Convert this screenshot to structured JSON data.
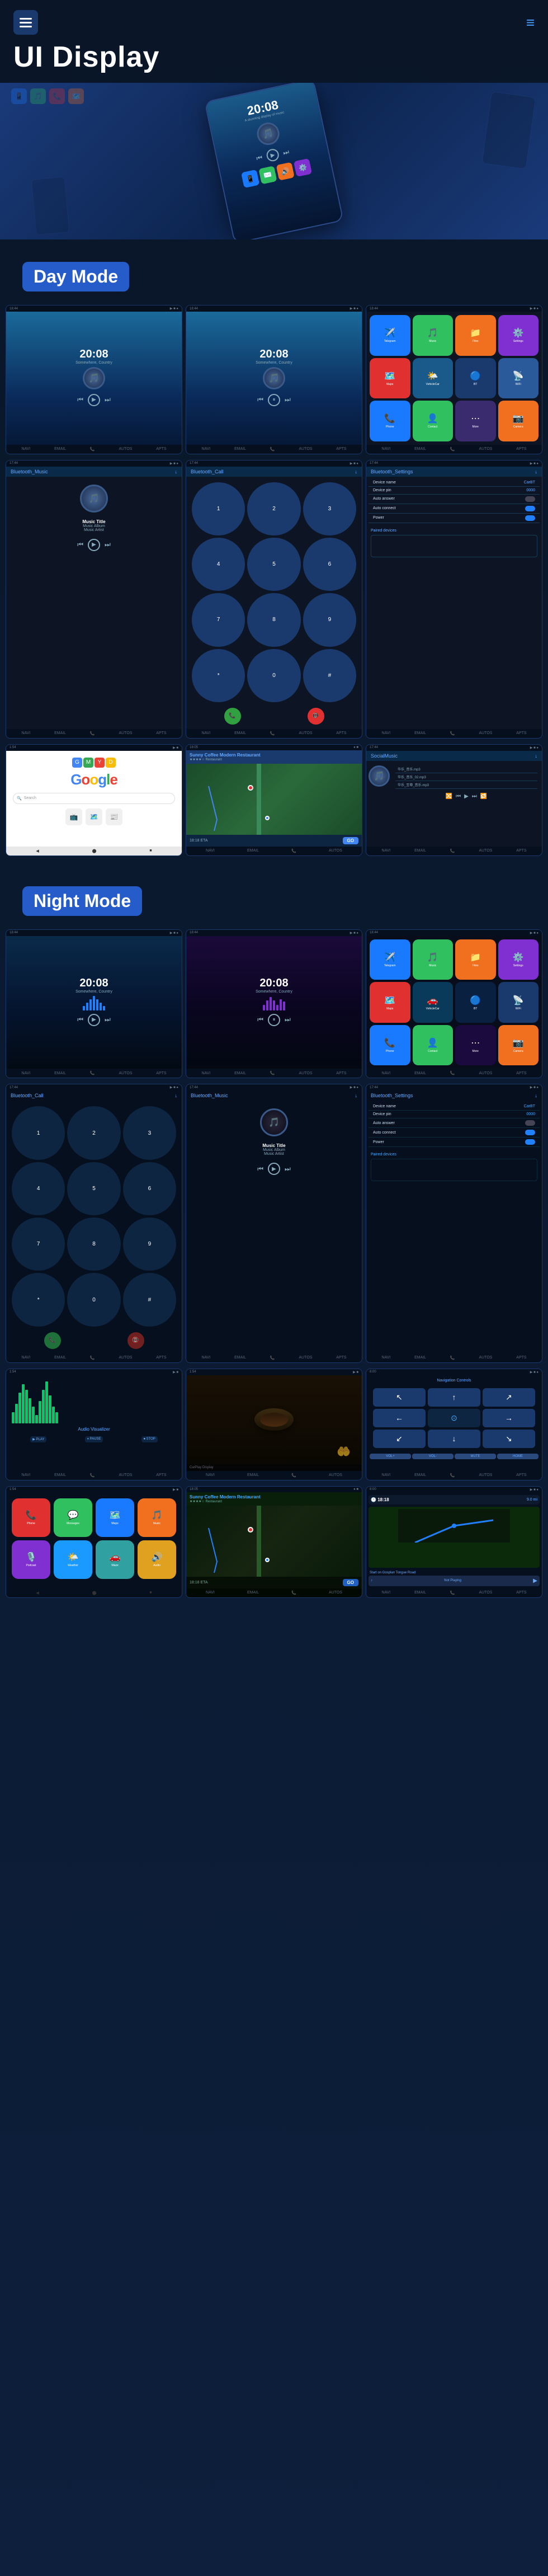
{
  "header": {
    "title": "UI Display",
    "menu_icon": "≡",
    "nav_icon": "≡"
  },
  "hero": {
    "time": "20:08",
    "subtitle": "A stunning display of music"
  },
  "day_mode": {
    "label": "Day Mode",
    "screens": [
      {
        "id": "day-music-1",
        "type": "music_player",
        "time": "20:08",
        "location": "Somewhere, Country",
        "has_player": true
      },
      {
        "id": "day-music-2",
        "type": "music_player",
        "time": "20:08",
        "location": "Somewhere, Country",
        "has_player": true
      },
      {
        "id": "day-apps",
        "type": "app_grid",
        "has_bt": true
      },
      {
        "id": "day-bt-music",
        "type": "bluetooth_music",
        "header": "Bluetooth_Music",
        "track_title": "Music Title",
        "track_album": "Music Album",
        "track_artist": "Music Artist"
      },
      {
        "id": "day-bt-call",
        "type": "bluetooth_call",
        "header": "Bluetooth_Call"
      },
      {
        "id": "day-bt-settings",
        "type": "bluetooth_settings",
        "header": "Bluetooth_Settings",
        "device_name_label": "Device name",
        "device_name_val": "CarBT",
        "device_pin_label": "Device pin",
        "device_pin_val": "0000",
        "auto_answer_label": "Auto answer",
        "auto_connect_label": "Auto connect",
        "power_label": "Power"
      },
      {
        "id": "day-google",
        "type": "google",
        "search_placeholder": "Search"
      },
      {
        "id": "day-map",
        "type": "map",
        "restaurant": "Sunny Coffee Modern Restaurant",
        "eta_label": "18:18 ETA",
        "eta_time": "18:18",
        "go_label": "GO"
      },
      {
        "id": "day-local-music",
        "type": "local_music",
        "header": "SocialMusic",
        "files": [
          "华乐_音乐.mp3",
          "华乐_音乐_02.mp3",
          "华乐_至尊_音乐.mp3"
        ]
      }
    ]
  },
  "night_mode": {
    "label": "Night Mode",
    "screens": [
      {
        "id": "night-music-1",
        "type": "music_player_dark",
        "time": "20:08",
        "location": "Somewhere, Country"
      },
      {
        "id": "night-music-2",
        "type": "music_player_dark",
        "time": "20:08",
        "location": "Somewhere, Country"
      },
      {
        "id": "night-apps",
        "type": "app_grid_dark"
      },
      {
        "id": "night-bt-call",
        "type": "bluetooth_call_dark",
        "header": "Bluetooth_Call"
      },
      {
        "id": "night-bt-music",
        "type": "bluetooth_music_dark",
        "header": "Bluetooth_Music",
        "track_title": "Music Title",
        "track_album": "Music Album",
        "track_artist": "Music Artist"
      },
      {
        "id": "night-bt-settings",
        "type": "bluetooth_settings_dark",
        "header": "Bluetooth_Settings",
        "device_name_label": "Device name",
        "device_name_val": "CarBT",
        "device_pin_label": "Device pin",
        "device_pin_val": "0000",
        "auto_answer_label": "Auto answer",
        "auto_connect_label": "Auto connect",
        "power_label": "Power"
      },
      {
        "id": "night-video",
        "type": "video_screen"
      },
      {
        "id": "night-carplay",
        "type": "carplay_screen"
      },
      {
        "id": "night-nav-arrows",
        "type": "nav_arrows_screen"
      },
      {
        "id": "night-google",
        "type": "carplay_icons"
      },
      {
        "id": "night-map",
        "type": "map_night",
        "restaurant": "Sunny Coffee Modern Restaurant",
        "eta_label": "18:18 ETA",
        "go_label": "GO"
      },
      {
        "id": "night-nav-info",
        "type": "nav_info_night",
        "distance": "9.0 mi",
        "road": "Start on Gosplan Tongue Road",
        "not_playing": "Not Playing"
      }
    ]
  },
  "bottom_bar": {
    "items": [
      "NAVI",
      "EMAIL",
      "📞",
      "AUTOS",
      "APTS"
    ]
  },
  "app_colors": {
    "green": "#30c060",
    "blue": "#1a7aff",
    "red": "#e03030",
    "orange": "#f07020",
    "purple": "#8030d0",
    "teal": "#00aaaa",
    "pink": "#e060a0",
    "yellow": "#e0c020"
  }
}
